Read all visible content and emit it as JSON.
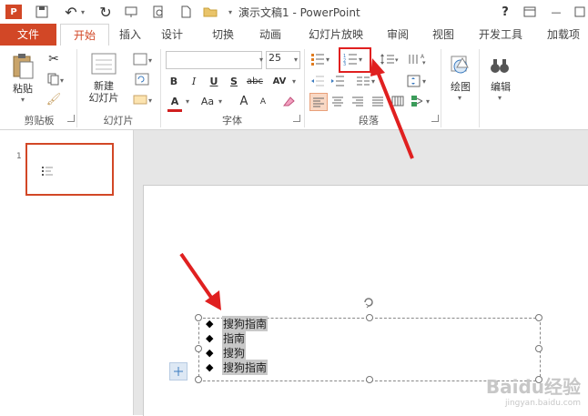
{
  "app": {
    "title": "演示文稿1 - PowerPoint",
    "help": "?",
    "min": "—"
  },
  "tabs": [
    "文件",
    "开始",
    "插入",
    "设计",
    "切换",
    "动画",
    "幻灯片放映",
    "审阅",
    "视图",
    "开发工具",
    "加载项"
  ],
  "ribbon": {
    "clipboard": {
      "paste": "粘贴",
      "label": "剪贴板"
    },
    "slides": {
      "new_slide": "新建\n幻灯片",
      "label": "幻灯片"
    },
    "font": {
      "font_name": "",
      "font_size": "25",
      "bold": "B",
      "italic": "I",
      "underline": "U",
      "shadow": "S",
      "strike": "abc",
      "spacing": "AV",
      "case": "Aa",
      "grow": "A",
      "shrink": "A",
      "label": "字体"
    },
    "paragraph": {
      "label": "段落"
    },
    "drawing": {
      "label": "绘图"
    },
    "editing": {
      "label": "编辑"
    }
  },
  "slide_thumb": {
    "number": "1"
  },
  "bullets": [
    "搜狗指南",
    "指南",
    "搜狗",
    "搜狗指南"
  ],
  "watermark": {
    "brand": "Baidu经验",
    "url": "jingyan.baidu.com"
  },
  "colors": {
    "accent": "#d24726",
    "highlight_box": "#e02020"
  }
}
